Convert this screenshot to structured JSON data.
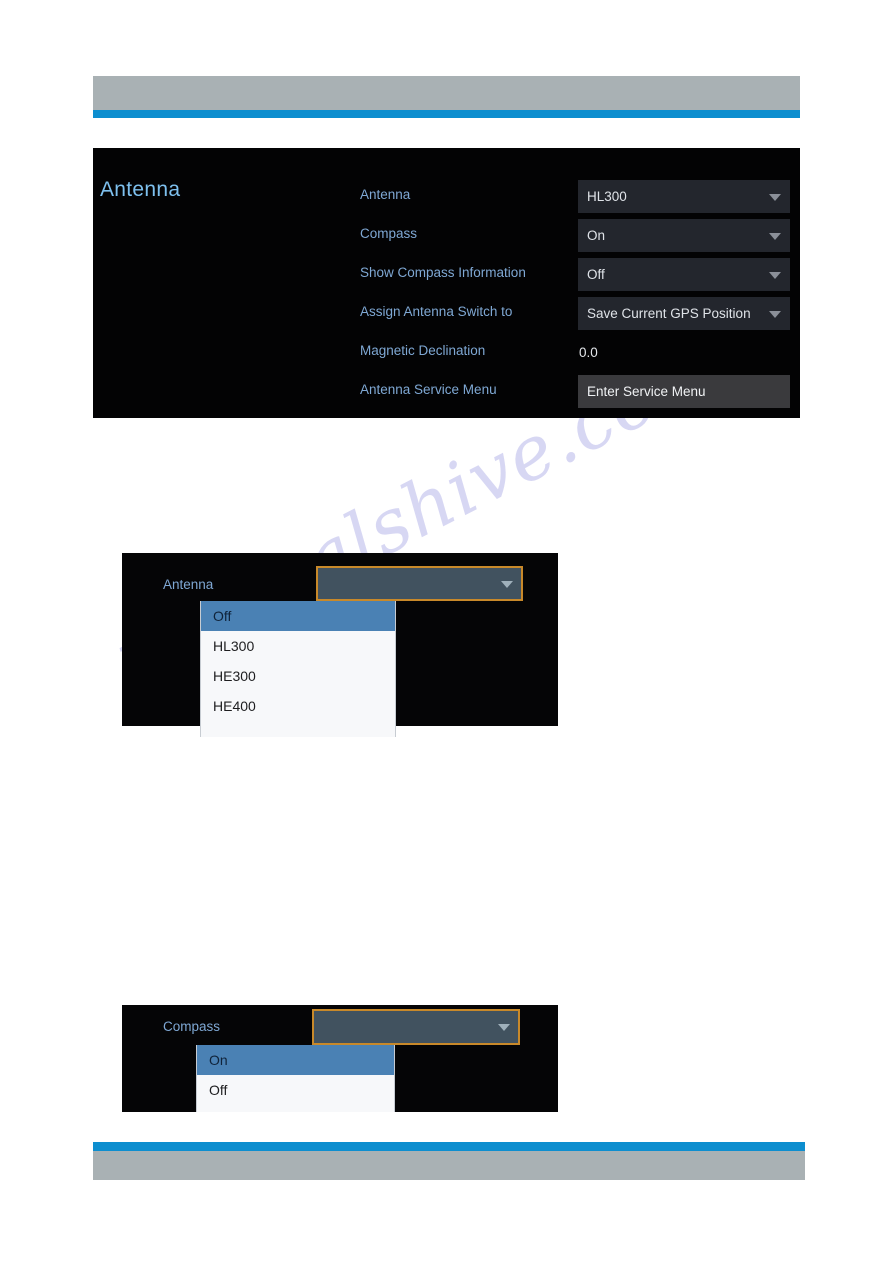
{
  "page": {
    "title": "Antenna",
    "watermark": "manualshive.com"
  },
  "theme": {
    "accent_blue": "#0d8ecf",
    "band_gray": "#a9b1b4",
    "label_blue": "#7fa8d4",
    "title_blue": "#7ec0ee",
    "panel_black": "#030304",
    "select_fill": "#23262d",
    "focus_orange": "#c8892a",
    "highlight_blue": "#4a81b4",
    "list_white": "#f7f8fa"
  },
  "main_panel": {
    "title": "Antenna",
    "rows": [
      {
        "label": "Antenna",
        "type": "select",
        "value": "HL300",
        "icon": "chevron-down-icon"
      },
      {
        "label": "Compass",
        "type": "select",
        "value": "On",
        "icon": "chevron-down-icon"
      },
      {
        "label": "Show Compass Information",
        "type": "select",
        "value": "Off",
        "icon": "chevron-down-icon"
      },
      {
        "label": "Assign Antenna Switch to",
        "type": "select",
        "value": "Save Current GPS Position",
        "icon": "chevron-down-icon"
      },
      {
        "label": "Magnetic Declination",
        "type": "text",
        "value": "0.0"
      },
      {
        "label": "Antenna Service Menu",
        "type": "button",
        "value": "Enter Service Menu"
      }
    ]
  },
  "antenna_dropdown": {
    "label": "Antenna",
    "closed_value": "",
    "icon": "chevron-down-icon",
    "options": [
      {
        "label": "Off",
        "selected": true
      },
      {
        "label": "HL300",
        "selected": false
      },
      {
        "label": "HE300",
        "selected": false
      },
      {
        "label": "HE400",
        "selected": false
      }
    ]
  },
  "compass_dropdown": {
    "label": "Compass",
    "closed_value": "",
    "icon": "chevron-down-icon",
    "options": [
      {
        "label": "On",
        "selected": true
      },
      {
        "label": "Off",
        "selected": false
      }
    ]
  }
}
